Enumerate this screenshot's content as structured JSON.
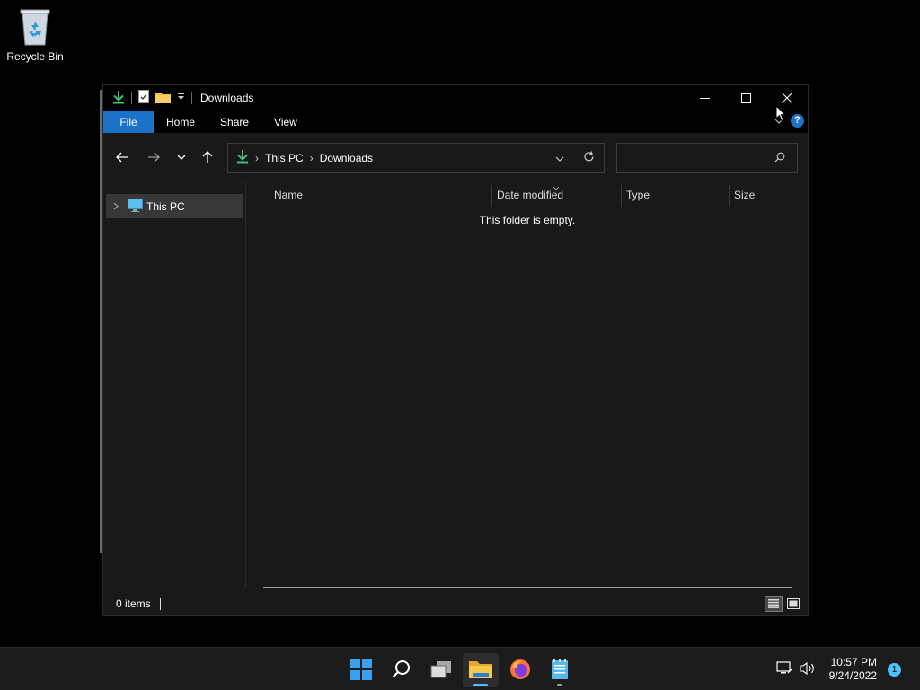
{
  "desktop": {
    "recycle_bin_label": "Recycle Bin"
  },
  "window": {
    "title": "Downloads",
    "ribbon_tabs": [
      "File",
      "Home",
      "Share",
      "View"
    ],
    "address": {
      "crumbs": [
        "This PC",
        "Downloads"
      ]
    },
    "search": {
      "placeholder": ""
    },
    "nav_pane": {
      "items": [
        {
          "label": "This PC"
        }
      ]
    },
    "columns": [
      "Name",
      "Date modified",
      "Type",
      "Size"
    ],
    "empty_message": "This folder is empty.",
    "status": {
      "item_count": "0 items"
    }
  },
  "taskbar": {
    "apps": [
      "start-icon",
      "search-icon",
      "task-view-icon",
      "file-explorer-icon",
      "firefox-icon",
      "notepad-icon"
    ],
    "clock": {
      "time": "10:57 PM",
      "date": "9/24/2022"
    },
    "notification_count": "1"
  },
  "colors": {
    "accent": "#1a73c8",
    "download_green": "#3fc07a",
    "window_bg": "#191919"
  }
}
